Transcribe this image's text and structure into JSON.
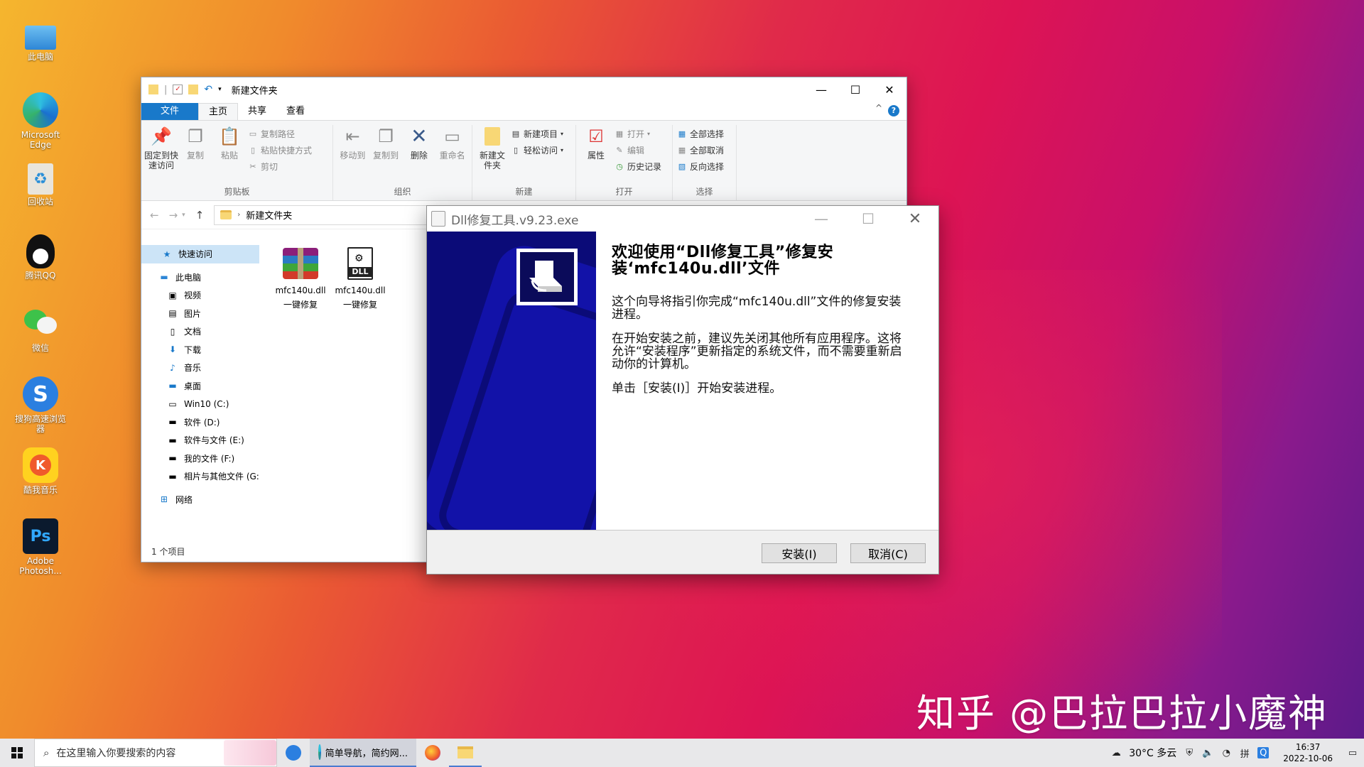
{
  "desktop": {
    "icons": [
      {
        "label": "此电脑",
        "icon": "computer-icon"
      },
      {
        "label": "Microsoft Edge",
        "icon": "edge-icon"
      },
      {
        "label": "回收站",
        "icon": "recycle-bin-icon"
      },
      {
        "label": "腾讯QQ",
        "icon": "qq-icon"
      },
      {
        "label": "微信",
        "icon": "wechat-icon"
      },
      {
        "label": "搜狗高速浏览器",
        "icon": "sogou-browser-icon"
      },
      {
        "label": "酷我音乐",
        "icon": "kuwo-music-icon"
      },
      {
        "label": "Adobe Photosh...",
        "icon": "photoshop-icon"
      }
    ],
    "watermark": "知乎 @巴拉巴拉小魔神"
  },
  "explorer": {
    "title": "新建文件夹",
    "tabs": [
      "文件",
      "主页",
      "共享",
      "查看"
    ],
    "ribbon": {
      "clipboard": {
        "name": "剪贴板",
        "pin": "固定到快速访问",
        "copy": "复制",
        "paste": "粘贴",
        "copy_path": "复制路径",
        "paste_shortcut": "粘贴快捷方式",
        "cut": "剪切"
      },
      "organize": {
        "name": "组织",
        "move_to": "移动到",
        "copy_to": "复制到",
        "delete": "删除",
        "rename": "重命名"
      },
      "new": {
        "name": "新建",
        "new_folder": "新建文件夹",
        "new_item": "新建项目",
        "easy_access": "轻松访问"
      },
      "open": {
        "name": "打开",
        "properties": "属性",
        "open": "打开",
        "edit": "编辑",
        "history": "历史记录"
      },
      "select": {
        "name": "选择",
        "select_all": "全部选择",
        "select_none": "全部取消",
        "invert": "反向选择"
      }
    },
    "address": {
      "path": "新建文件夹"
    },
    "nav": {
      "quick_access": "快速访问",
      "this_pc": "此电脑",
      "items": [
        "视频",
        "图片",
        "文档",
        "下载",
        "音乐",
        "桌面",
        "Win10 (C:)",
        "软件 (D:)",
        "软件与文件 (E:)",
        "我的文件 (F:)",
        "相片与其他文件 (G:"
      ],
      "network": "网络"
    },
    "files": [
      {
        "name": "mfc140u.dll",
        "sub": "一键修复",
        "type": "rar"
      },
      {
        "name": "mfc140u.dll",
        "sub": "一键修复",
        "type": "dll"
      }
    ],
    "status": "1 个项目"
  },
  "dialog": {
    "title": "Dll修复工具.v9.23.exe",
    "heading": "欢迎使用“Dll修复工具”修复安装‘mfc140u.dll’文件",
    "p1": "这个向导将指引你完成“mfc140u.dll”文件的修复安装进程。",
    "p2": "在开始安装之前，建议先关闭其他所有应用程序。这将允许“安装程序”更新指定的系统文件，而不需要重新启动你的计算机。",
    "p3": "单击［安装(I)］开始安装进程。",
    "install": "安装(I)",
    "cancel": "取消(C)"
  },
  "taskbar": {
    "search_placeholder": "在这里输入你要搜索的内容",
    "edge_label": "简单导航，简约网...",
    "weather": "30°C 多云",
    "time": "16:37",
    "date": "2022-10-06"
  }
}
